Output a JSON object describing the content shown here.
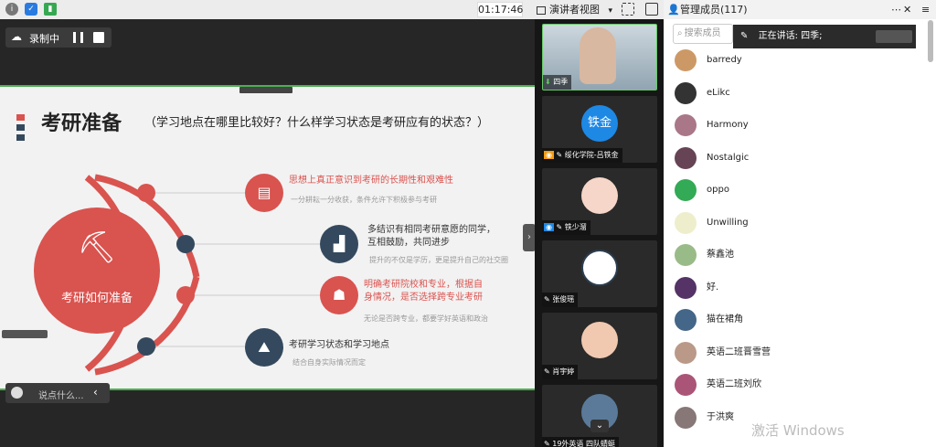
{
  "topbar": {
    "timer": "01:17:46",
    "presenter_view": "演讲者视图",
    "presenter_caret": "▾",
    "info_icon": "info-icon",
    "shield_icon": "shield-icon",
    "signal_icon": "signal-icon"
  },
  "stage": {
    "recording_label": "录制中",
    "slide": {
      "title": "考研准备",
      "subtitle": "（学习地点在哪里比较好？什么样学习状态是考研应有的状态？）",
      "center_label": "考研如何准备",
      "items": [
        {
          "title": "思想上真正意识到考研的长期性和艰难性",
          "desc": "一分耕耘一分收获，条件允许下积极参与考研"
        },
        {
          "title": "多结识有相同考研意愿的同学，互相鼓励，共同进步",
          "title_1": "多结识有相同考研意愿的同学，",
          "title_2": "互相鼓励，共同进步",
          "desc": "提升的不仅是学历，更是提升自己的社交圈"
        },
        {
          "title": "明确考研院校和专业，根据自身情况，是否选择跨专业考研",
          "title_1": "明确考研院校和专业，根据自",
          "title_2": "身情况，是否选择跨专业考研",
          "desc": "无论是否跨专业，都要学好英语和政治"
        },
        {
          "title": "考研学习状态和学习地点",
          "desc": "结合自身实际情况而定"
        }
      ]
    },
    "chat_placeholder": "说点什么..."
  },
  "videos": [
    {
      "name": "四季",
      "avatar": ""
    },
    {
      "name": "绥化学院-吕铁金",
      "avatar": "铁金"
    },
    {
      "name": "铁少溜",
      "avatar": ""
    },
    {
      "name": "张俊瑶",
      "avatar": ""
    },
    {
      "name": "肖宇婷",
      "avatar": ""
    },
    {
      "name": "19外英语 四队蜻蜓",
      "avatar": ""
    }
  ],
  "panel": {
    "title": "管理成员(117)",
    "more_icon": "⋯",
    "close_icon": "✕",
    "menu_icon": "≡",
    "search_placeholder": "搜索成员",
    "speaking": "正在讲话: 四季;",
    "members": [
      {
        "name": "barredy",
        "color": "#c96"
      },
      {
        "name": "eLikc",
        "color": "#333"
      },
      {
        "name": "Harmony",
        "color": "#a78"
      },
      {
        "name": "Nostalgic",
        "color": "#645"
      },
      {
        "name": "oppo",
        "color": "#3a5"
      },
      {
        "name": "Unwilling",
        "color": "#eec"
      },
      {
        "name": "蔡鑫池",
        "color": "#9b8"
      },
      {
        "name": "好.",
        "color": "#536"
      },
      {
        "name": "猫在裙角",
        "color": "#468"
      },
      {
        "name": "英语二班晋雪营",
        "color": "#b98"
      },
      {
        "name": "英语二班刘欣",
        "color": "#a57"
      },
      {
        "name": "于洪爽",
        "color": "#877"
      }
    ],
    "watermark": "激活 Windows"
  },
  "colors": {
    "accent_red": "#d9534f",
    "dark_navy": "#34495e",
    "dot_red": "#d9534f",
    "green_border": "#4caf50"
  }
}
